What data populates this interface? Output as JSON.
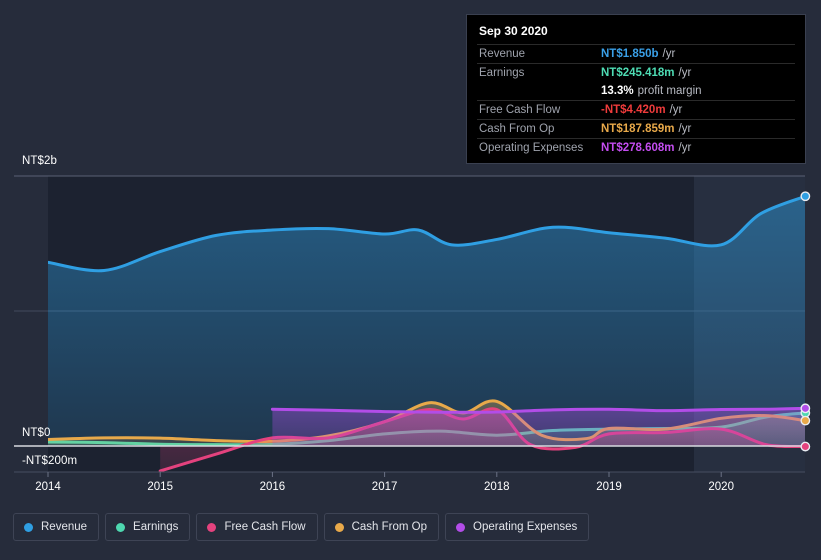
{
  "tooltip": {
    "title": "Sep 30 2020",
    "rows": [
      {
        "key": "Revenue",
        "value": "NT$1.850b",
        "unit": "/yr",
        "color": "#3aa0e8"
      },
      {
        "key": "Earnings",
        "value": "NT$245.418m",
        "unit": "/yr",
        "color": "#4edcb4"
      },
      {
        "key": "",
        "value": "13.3%",
        "unit": "profit margin",
        "color": "#ffffff",
        "no_rule": true
      },
      {
        "key": "Free Cash Flow",
        "value": "-NT$4.420m",
        "unit": "/yr",
        "color": "#ef3b3b"
      },
      {
        "key": "Cash From Op",
        "value": "NT$187.859m",
        "unit": "/yr",
        "color": "#e8a94a"
      },
      {
        "key": "Operating Expenses",
        "value": "NT$278.608m",
        "unit": "/yr",
        "color": "#c44df0"
      }
    ]
  },
  "legend": {
    "items": [
      {
        "label": "Revenue",
        "color": "#2f9fe3"
      },
      {
        "label": "Earnings",
        "color": "#4ed8b0"
      },
      {
        "label": "Free Cash Flow",
        "color": "#e4427e"
      },
      {
        "label": "Cash From Op",
        "color": "#e8a94a"
      },
      {
        "label": "Operating Expenses",
        "color": "#b24de8"
      }
    ]
  },
  "axis": {
    "y_top_label": "NT$2b",
    "y_zero_label": "NT$0",
    "y_negative_label": "-NT$200m",
    "x_labels": [
      "2014",
      "2015",
      "2016",
      "2017",
      "2018",
      "2019",
      "2020"
    ]
  },
  "chart_data": {
    "type": "area",
    "title": "",
    "xlabel": "",
    "ylabel": "NT$",
    "ylim": [
      -200000000,
      2000000000
    ],
    "y_ticks": [
      "NT$2b",
      "NT$0",
      "-NT$200m"
    ],
    "grid": true,
    "legend_position": "bottom",
    "currency": "NT$",
    "x": [
      "2014",
      "2015",
      "2016",
      "2017",
      "2018",
      "2019",
      "2020",
      "2020-Q3"
    ],
    "highlight_band": {
      "from": "2020",
      "to": "2020-Q3"
    },
    "series": [
      {
        "name": "Revenue",
        "color": "#2f9fe3",
        "unit": "NT$",
        "x": [
          2014.0,
          2014.5,
          2015.0,
          2015.5,
          2016.0,
          2016.5,
          2017.0,
          2017.3,
          2017.6,
          2018.0,
          2018.5,
          2019.0,
          2019.5,
          2020.0,
          2020.35,
          2020.75
        ],
        "values": [
          1.36,
          1.3,
          1.44,
          1.56,
          1.6,
          1.61,
          1.57,
          1.6,
          1.49,
          1.53,
          1.62,
          1.58,
          1.54,
          1.49,
          1.72,
          1.85
        ]
      },
      {
        "name": "Earnings",
        "color": "#4ed8b0",
        "unit": "NT$",
        "x": [
          2014.0,
          2014.5,
          2015.0,
          2015.5,
          2016.0,
          2016.5,
          2017.0,
          2017.5,
          2018.0,
          2018.5,
          2019.0,
          2019.5,
          2020.0,
          2020.4,
          2020.75
        ],
        "values": [
          0.03,
          0.025,
          0.013,
          0.01,
          0.012,
          0.04,
          0.09,
          0.11,
          0.08,
          0.115,
          0.125,
          0.13,
          0.14,
          0.215,
          0.245
        ]
      },
      {
        "name": "Free Cash Flow",
        "color": "#e4427e",
        "unit": "NT$",
        "x": [
          2015.0,
          2015.5,
          2016.0,
          2016.5,
          2017.0,
          2017.4,
          2017.7,
          2018.0,
          2018.3,
          2018.7,
          2019.0,
          2019.5,
          2020.0,
          2020.4,
          2020.75
        ],
        "values": [
          -0.185,
          -0.06,
          0.06,
          0.06,
          0.18,
          0.27,
          0.2,
          0.27,
          0.01,
          -0.01,
          0.09,
          0.1,
          0.125,
          0.01,
          -0.004
        ]
      },
      {
        "name": "Cash From Op",
        "color": "#e8a94a",
        "unit": "NT$",
        "x": [
          2014.0,
          2014.5,
          2015.0,
          2015.5,
          2016.0,
          2016.5,
          2017.0,
          2017.4,
          2017.7,
          2018.0,
          2018.4,
          2018.8,
          2019.0,
          2019.5,
          2020.0,
          2020.4,
          2020.75
        ],
        "values": [
          0.048,
          0.06,
          0.058,
          0.04,
          0.035,
          0.075,
          0.18,
          0.32,
          0.245,
          0.33,
          0.08,
          0.055,
          0.13,
          0.125,
          0.205,
          0.225,
          0.188
        ]
      },
      {
        "name": "Operating Expenses",
        "color": "#b24de8",
        "unit": "NT$",
        "x": [
          2016.0,
          2016.5,
          2017.0,
          2017.5,
          2018.0,
          2018.5,
          2019.0,
          2019.5,
          2020.0,
          2020.4,
          2020.75
        ],
        "values": [
          0.272,
          0.265,
          0.255,
          0.25,
          0.252,
          0.268,
          0.272,
          0.262,
          0.27,
          0.272,
          0.279
        ]
      }
    ]
  }
}
